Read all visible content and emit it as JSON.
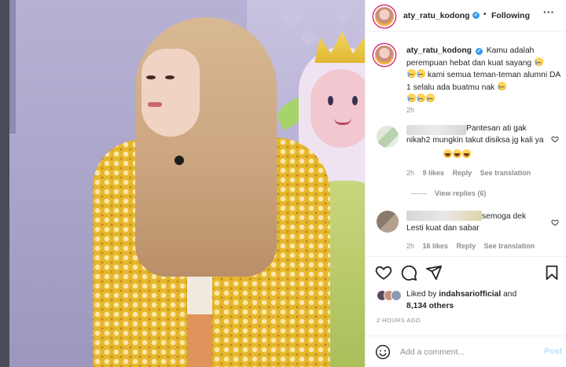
{
  "post": {
    "author": "aty_ratu_kodong",
    "follow_separator": "•",
    "follow_status": "Following",
    "more_icon": "more-horizontal-icon"
  },
  "caption": {
    "username": "aty_ratu_kodong",
    "line1": "Kamu adalah perempuan hebat dan kuat sayang",
    "line2": "kami semua teman-teman alumni DA 1 selalu ada buatmu nak",
    "time": "2h"
  },
  "comments": [
    {
      "text_visible": "Pantesan ati gak nikah2 mungkin takut disiksa jg kali ya",
      "time": "2h",
      "likes": "9 likes",
      "reply": "Reply",
      "translate": "See translation",
      "replies": "View replies (6)"
    },
    {
      "text_visible_start": "semoga dek",
      "text_visible_end": "Lesti kuat dan sabar",
      "time": "2h",
      "likes": "16 likes",
      "reply": "Reply",
      "translate": "See translation"
    }
  ],
  "actions": {
    "like_icon": "heart-icon",
    "comment_icon": "comment-icon",
    "share_icon": "share-icon",
    "save_icon": "bookmark-icon"
  },
  "likes": {
    "prefix": "Liked by",
    "user": "indahsariofficial",
    "and": "and",
    "others": "8,134 others"
  },
  "post_time": "2 HOURS AGO",
  "add_comment": {
    "placeholder": "Add a comment...",
    "post_label": "Post",
    "emoji_icon": "smiley-icon"
  },
  "colors": {
    "verified": "#3897f0",
    "post_disabled": "#b2dffc",
    "muted": "#8e8e8e",
    "text": "#262626"
  }
}
